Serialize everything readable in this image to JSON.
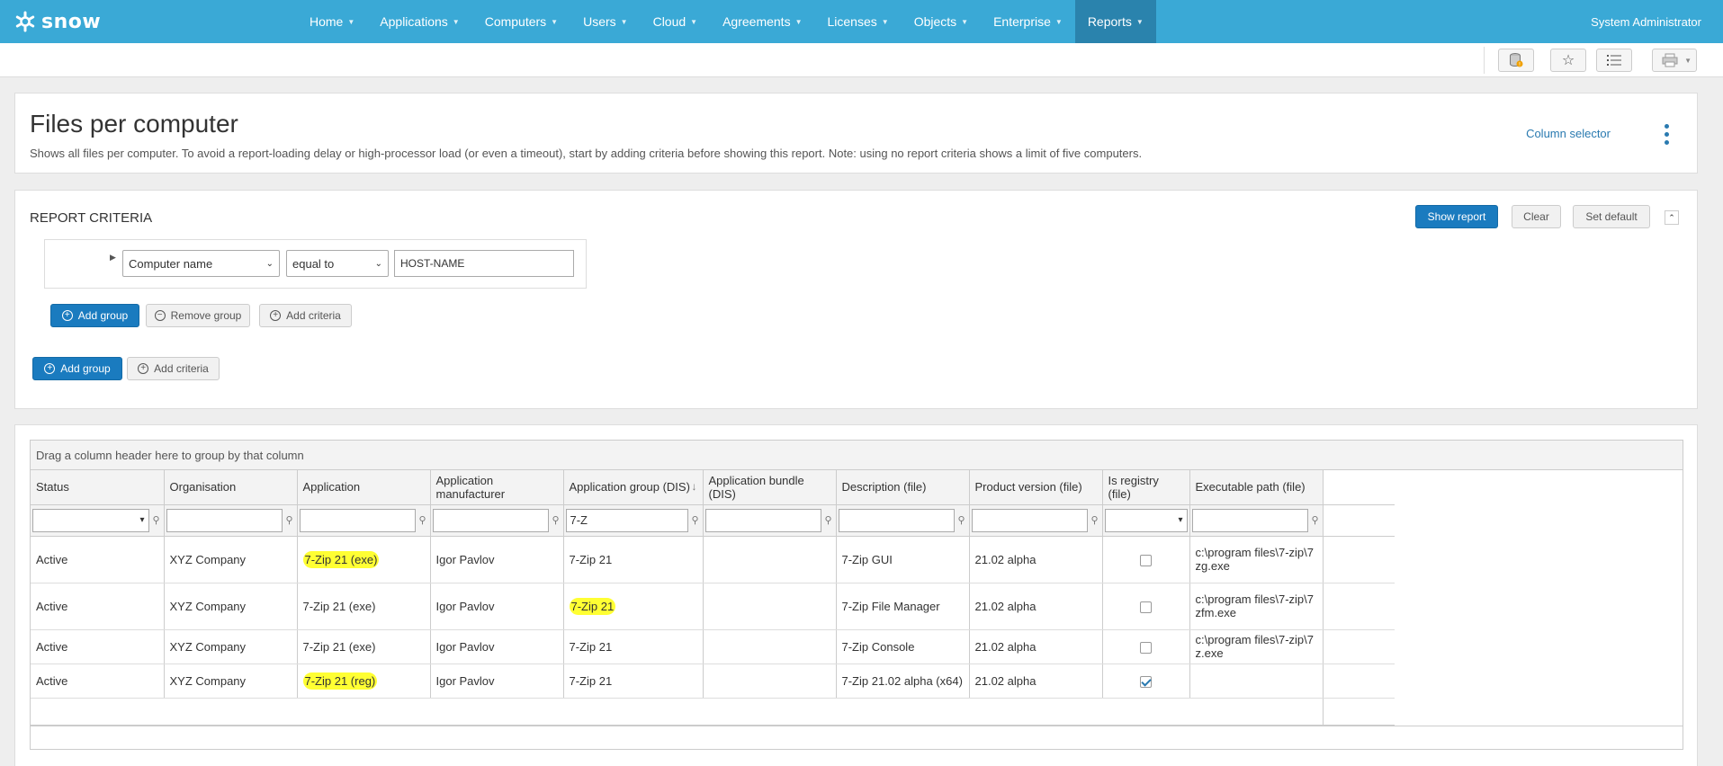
{
  "app": {
    "logo_text": "snow",
    "user": "System Administrator"
  },
  "nav": [
    {
      "label": "Home",
      "active": false
    },
    {
      "label": "Applications",
      "active": false
    },
    {
      "label": "Computers",
      "active": false
    },
    {
      "label": "Users",
      "active": false
    },
    {
      "label": "Cloud",
      "active": false
    },
    {
      "label": "Agreements",
      "active": false
    },
    {
      "label": "Licenses",
      "active": false
    },
    {
      "label": "Objects",
      "active": false
    },
    {
      "label": "Enterprise",
      "active": false
    },
    {
      "label": "Reports",
      "active": true
    }
  ],
  "toolbar": {
    "icons": [
      "database-warning-icon",
      "star-icon",
      "list-icon",
      "printer-icon",
      "chevron-down-icon"
    ]
  },
  "header": {
    "title": "Files per computer",
    "description": "Shows all files per computer. To avoid a report-loading delay or high-processor load (or even a timeout), start by adding criteria before showing this report. Note: using no report criteria shows a limit of five computers.",
    "column_selector": "Column selector"
  },
  "criteria": {
    "title": "REPORT CRITERIA",
    "show_report": "Show report",
    "clear": "Clear",
    "set_default": "Set default",
    "field": "Computer name",
    "operator": "equal to",
    "value": "HOST-NAME",
    "inner_add_group": "Add group",
    "inner_remove_group": "Remove group",
    "inner_add_criteria": "Add criteria",
    "outer_add_group": "Add group",
    "outer_add_criteria": "Add criteria"
  },
  "grid": {
    "group_hint": "Drag a column header here to group by that column",
    "columns": [
      "Status",
      "Organisation",
      "Application",
      "Application manufacturer",
      "Application group (DIS)",
      "Application bundle (DIS)",
      "Description (file)",
      "Product version (file)",
      "Is registry (file)",
      "Executable path (file)"
    ],
    "filters": [
      "",
      "",
      "",
      "",
      "7-Z",
      "",
      "",
      "",
      "",
      ""
    ],
    "rows": [
      [
        "Active",
        "XYZ Company",
        "7-Zip 21 (exe)",
        "Igor Pavlov",
        "7-Zip 21",
        "",
        "7-Zip GUI",
        "21.02 alpha",
        "",
        "c:\\program files\\7-zip\\7zg.exe"
      ],
      [
        "Active",
        "XYZ Company",
        "7-Zip 21 (exe)",
        "Igor Pavlov",
        "7-Zip 21",
        "",
        "7-Zip File Manager",
        "21.02 alpha",
        "",
        "c:\\program files\\7-zip\\7zfm.exe"
      ],
      [
        "Active",
        "XYZ Company",
        "7-Zip 21 (exe)",
        "Igor Pavlov",
        "7-Zip 21",
        "",
        "7-Zip Console",
        "21.02 alpha",
        "",
        "c:\\program files\\7-zip\\7z.exe"
      ],
      [
        "Active",
        "XYZ Company",
        "7-Zip 21 (reg)",
        "Igor Pavlov",
        "7-Zip 21",
        "",
        "7-Zip 21.02 alpha (x64)",
        "21.02 alpha",
        "",
        ""
      ]
    ],
    "registry_checked": [
      false,
      false,
      false,
      true
    ]
  },
  "colors": {
    "nav_bg": "#3aa9d6",
    "nav_active": "#2a83ad",
    "primary": "#1a7bbf",
    "highlight": "#ffff33"
  }
}
